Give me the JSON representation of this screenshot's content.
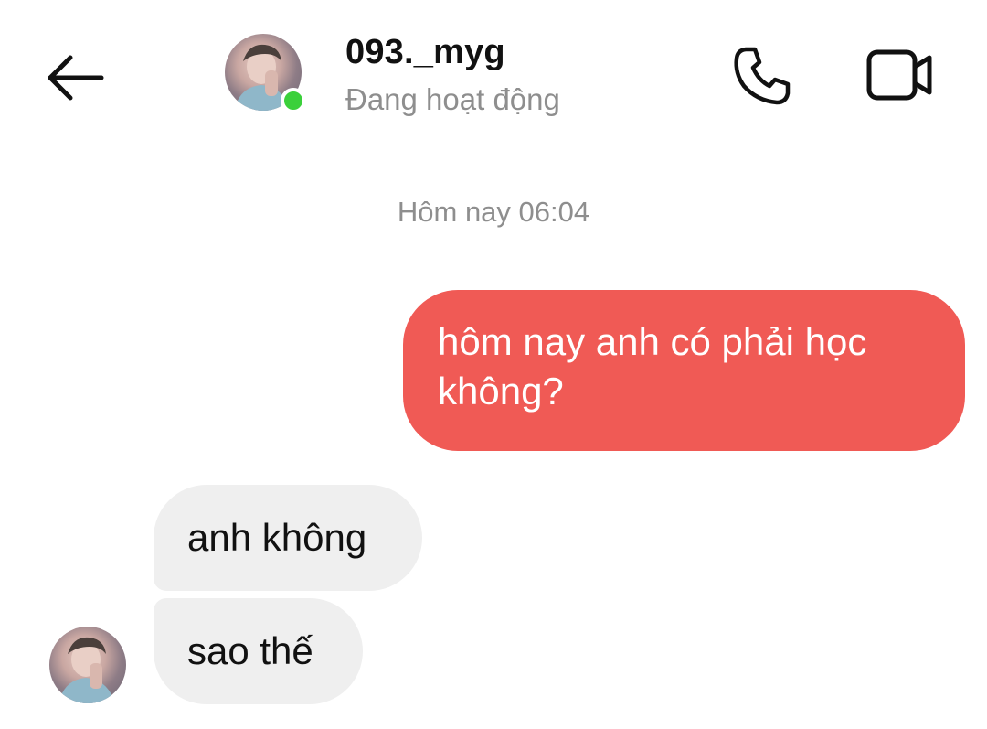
{
  "header": {
    "back_icon": "arrow-left-icon",
    "contact_name": "093._myg",
    "contact_status": "Đang hoạt động",
    "status_color": "#3bd03b",
    "call_icon": "phone-icon",
    "video_icon": "video-camera-icon"
  },
  "chat": {
    "timestamp": "Hôm nay 06:04",
    "messages": [
      {
        "direction": "sent",
        "text": "hôm nay anh có phải học không?"
      },
      {
        "direction": "received",
        "text": "anh không"
      },
      {
        "direction": "received",
        "text": "sao thế"
      }
    ]
  },
  "colors": {
    "sent_bubble": "#f05a55",
    "received_bubble": "#efefef",
    "secondary_text": "#8e8e8e"
  }
}
